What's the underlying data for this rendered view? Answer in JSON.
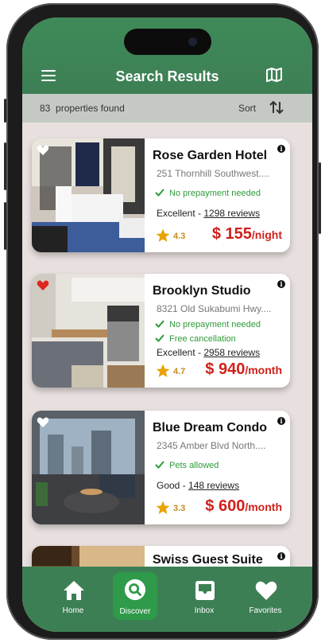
{
  "header": {
    "title": "Search Results"
  },
  "subbar": {
    "count": "83",
    "count_label": "properties found",
    "sort_label": "Sort"
  },
  "colors": {
    "brand": "#3d7f55",
    "price": "#d0211b",
    "feature": "#2e9a3a",
    "star": "#e9a200"
  },
  "listings": [
    {
      "name": "Rose Garden Hotel",
      "address": "251 Thornhill Southwest....",
      "features": [
        "No prepayment needed"
      ],
      "rating_word": "Excellent",
      "reviews": "1298 reviews",
      "score": "4.3",
      "price": "$ 155",
      "unit": "/night",
      "favorite": false
    },
    {
      "name": "Brooklyn Studio",
      "address": "8321 Old Sukabumi Hwy....",
      "features": [
        "No prepayment needed",
        "Free cancellation"
      ],
      "rating_word": "Excellent",
      "reviews": "2958 reviews",
      "score": "4.7",
      "price": "$ 940",
      "unit": "/month",
      "favorite": true
    },
    {
      "name": "Blue Dream Condo",
      "address": "2345 Amber Blvd North....",
      "features": [
        "Pets allowed"
      ],
      "rating_word": "Good",
      "reviews": "148 reviews",
      "score": "3.3",
      "price": "$ 600",
      "unit": "/month",
      "favorite": false
    },
    {
      "name": "Swiss Guest Suite"
    }
  ],
  "separator": " - ",
  "info_glyph": "i",
  "tabs": [
    {
      "label": "Home",
      "icon": "home-icon"
    },
    {
      "label": "Discover",
      "icon": "search-icon",
      "active": true
    },
    {
      "label": "Inbox",
      "icon": "inbox-icon"
    },
    {
      "label": "Favorites",
      "icon": "heart-icon"
    }
  ]
}
